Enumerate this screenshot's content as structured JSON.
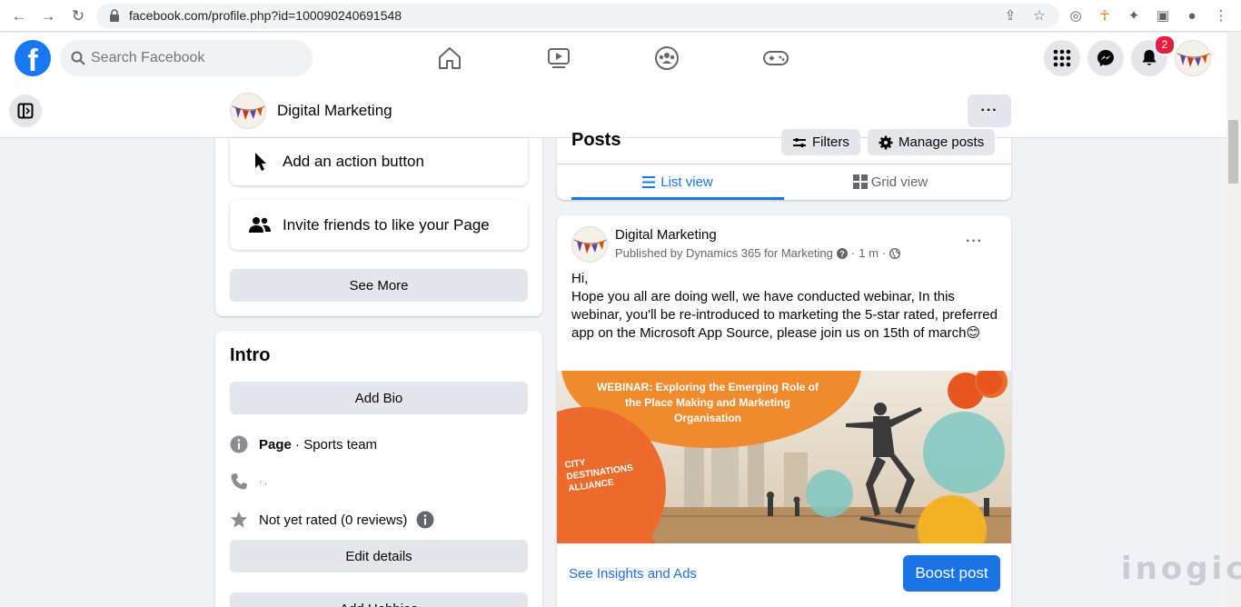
{
  "browser": {
    "url": "facebook.com/profile.php?id=100090240691548"
  },
  "fbnav": {
    "logo": "f",
    "search_placeholder": "Search Facebook",
    "notifications_badge": "2"
  },
  "pagebar": {
    "page_name": "Digital Marketing",
    "more_label": "···"
  },
  "actions": {
    "add_action_button": "Add an action button",
    "invite_friends": "Invite friends to like your Page",
    "see_more": "See More"
  },
  "intro": {
    "title": "Intro",
    "add_bio": "Add Bio",
    "page_label": "Page",
    "page_category": " · Sports team",
    "phone_value": "· .",
    "rating": "Not yet rated (0 reviews)",
    "edit_details": "Edit details",
    "add_hobbies": "Add Hobbies"
  },
  "posts": {
    "title": "Posts",
    "filters": "Filters",
    "manage_posts": "Manage posts",
    "list_view": "List view",
    "grid_view": "Grid view"
  },
  "post": {
    "author": "Digital Marketing",
    "published_by": "Published by Dynamics 365 for Marketing",
    "time": "1 m",
    "body_line1": "Hi,",
    "body_rest": "Hope you all are doing well, we have conducted webinar, In this webinar, you'll be re-introduced to marketing the 5-star rated, preferred app on the Microsoft App Source, please join us on 15th of march😊",
    "image_title": "WEBINAR: Exploring the Emerging Role of the Place Making and Marketing Organisation",
    "image_brand": "CITY DESTINATIONS ALLIANCE",
    "insights": "See Insights and Ads",
    "boost": "Boost post"
  },
  "watermark": "inogic",
  "colors": {
    "fb_blue": "#1877f2",
    "background": "#f0f2f5",
    "badge_red": "#e41e3f"
  }
}
